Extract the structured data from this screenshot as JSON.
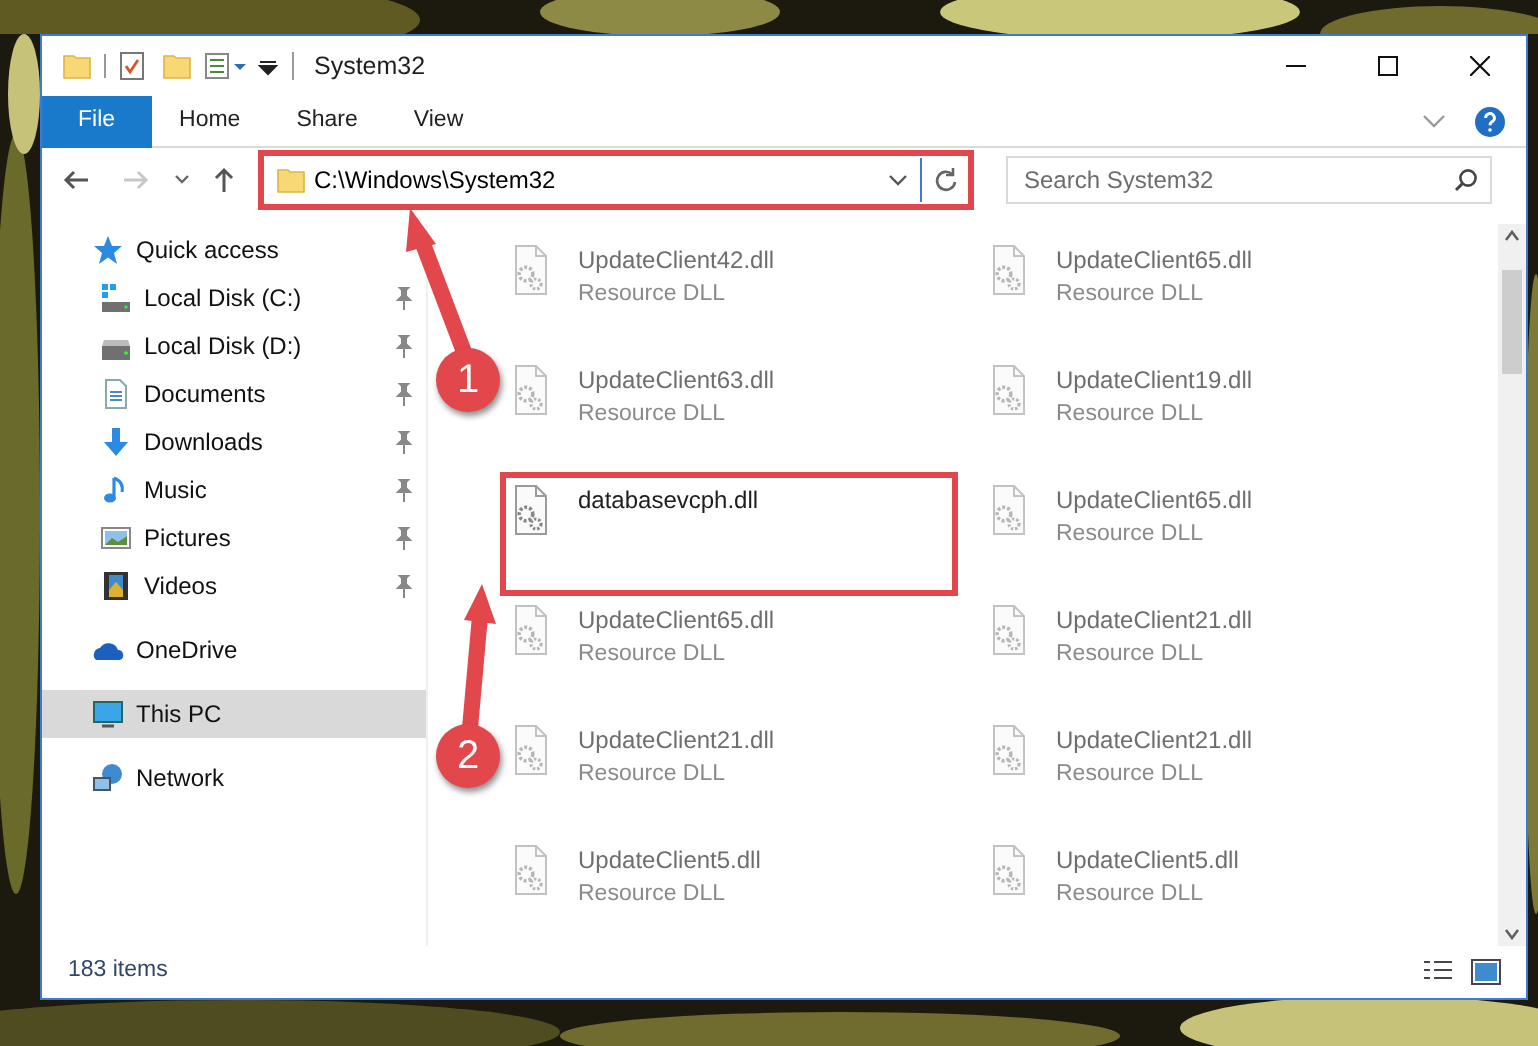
{
  "window": {
    "title": "System32"
  },
  "ribbon_tabs": [
    {
      "label": "File",
      "selected": true
    },
    {
      "label": "Home",
      "selected": false
    },
    {
      "label": "Share",
      "selected": false
    },
    {
      "label": "View",
      "selected": false
    }
  ],
  "address": {
    "value": "C:\\Windows\\System32",
    "highlighted": true
  },
  "search": {
    "placeholder": "Search System32"
  },
  "sidebar": {
    "items": [
      {
        "label": "Quick access",
        "kind": "star",
        "selected": false,
        "children": [
          {
            "label": "Local Disk (C:)",
            "kind": "system",
            "pinned": true,
            "selected": false
          },
          {
            "label": "Local Disk (D:)",
            "kind": "drive",
            "pinned": true,
            "selected": false
          },
          {
            "label": "Documents",
            "kind": "documents",
            "pinned": true,
            "selected": false
          },
          {
            "label": "Downloads",
            "kind": "downloads",
            "pinned": true,
            "selected": false
          },
          {
            "label": "Music",
            "kind": "music",
            "pinned": true,
            "selected": false
          },
          {
            "label": "Pictures",
            "kind": "pictures",
            "pinned": true,
            "selected": false
          },
          {
            "label": "Videos",
            "kind": "videos",
            "pinned": true,
            "selected": false
          }
        ]
      },
      {
        "label": "OneDrive",
        "kind": "cloud",
        "selected": false
      },
      {
        "label": "This PC",
        "kind": "computer",
        "selected": true
      },
      {
        "label": "Network",
        "kind": "network",
        "selected": false
      }
    ]
  },
  "files": [
    {
      "name": "UpdateClient42.dll",
      "type": "Resource DLL",
      "blurred": true,
      "highlighted": false
    },
    {
      "name": "UpdateClient65.dll",
      "type": "Resource DLL",
      "blurred": true,
      "highlighted": false
    },
    {
      "name": "UpdateClient63.dll",
      "type": "Resource DLL",
      "blurred": true,
      "highlighted": false
    },
    {
      "name": "UpdateClient19.dll",
      "type": "Resource DLL",
      "blurred": true,
      "highlighted": false
    },
    {
      "name": "databasevcph.dll",
      "blurred": false,
      "highlighted": true
    },
    {
      "name": "UpdateClient65.dll",
      "type": "Resource DLL",
      "blurred": true,
      "highlighted": false
    },
    {
      "name": "UpdateClient65.dll",
      "type": "Resource DLL",
      "blurred": true,
      "highlighted": false
    },
    {
      "name": "UpdateClient21.dll",
      "type": "Resource DLL",
      "blurred": true,
      "highlighted": false
    },
    {
      "name": "UpdateClient21.dll",
      "type": "Resource DLL",
      "blurred": true,
      "highlighted": false
    },
    {
      "name": "UpdateClient21.dll",
      "type": "Resource DLL",
      "blurred": true,
      "highlighted": false
    },
    {
      "name": "UpdateClient5.dll",
      "type": "Resource DLL",
      "blurred": true,
      "highlighted": false
    },
    {
      "name": "UpdateClient5.dll",
      "type": "Resource DLL",
      "blurred": true,
      "highlighted": false
    }
  ],
  "status_bar": {
    "item_count": "183 items"
  },
  "callouts": [
    {
      "number": "1"
    },
    {
      "number": "2"
    }
  ]
}
